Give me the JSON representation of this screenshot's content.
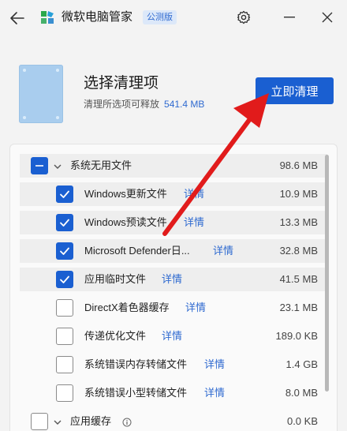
{
  "app": {
    "title": "微软电脑管家",
    "badge": "公测版"
  },
  "header": {
    "title": "选择清理项",
    "subtitle": "清理所选项可释放",
    "freeable_size": "541.4 MB",
    "clean_button": "立即清理"
  },
  "items": [
    {
      "label": "系统无用文件",
      "size": "98.6 MB",
      "state": "partial",
      "group": true
    },
    {
      "label": "Windows更新文件",
      "detail": "详情",
      "size": "10.9 MB",
      "state": "checked"
    },
    {
      "label": "Windows预读文件",
      "detail": "详情",
      "size": "13.3 MB",
      "state": "checked"
    },
    {
      "label": "Microsoft Defender日...",
      "detail": "详情",
      "size": "32.8 MB",
      "state": "checked"
    },
    {
      "label": "应用临时文件",
      "detail": "详情",
      "size": "41.5 MB",
      "state": "checked"
    },
    {
      "label": "DirectX着色器缓存",
      "detail": "详情",
      "size": "23.1 MB",
      "state": "unchecked"
    },
    {
      "label": "传递优化文件",
      "detail": "详情",
      "size": "189.0 KB",
      "state": "unchecked"
    },
    {
      "label": "系统错误内存转储文件",
      "detail": "详情",
      "size": "1.4 GB",
      "state": "unchecked"
    },
    {
      "label": "系统错误小型转储文件",
      "detail": "详情",
      "size": "8.0 MB",
      "state": "unchecked"
    },
    {
      "label": "应用缓存",
      "size": "0.0 KB",
      "state": "unchecked",
      "group": true,
      "info": true
    }
  ],
  "colors": {
    "accent": "#1a5fd1",
    "link": "#2f6ad0",
    "arrow": "#e11b1b"
  }
}
